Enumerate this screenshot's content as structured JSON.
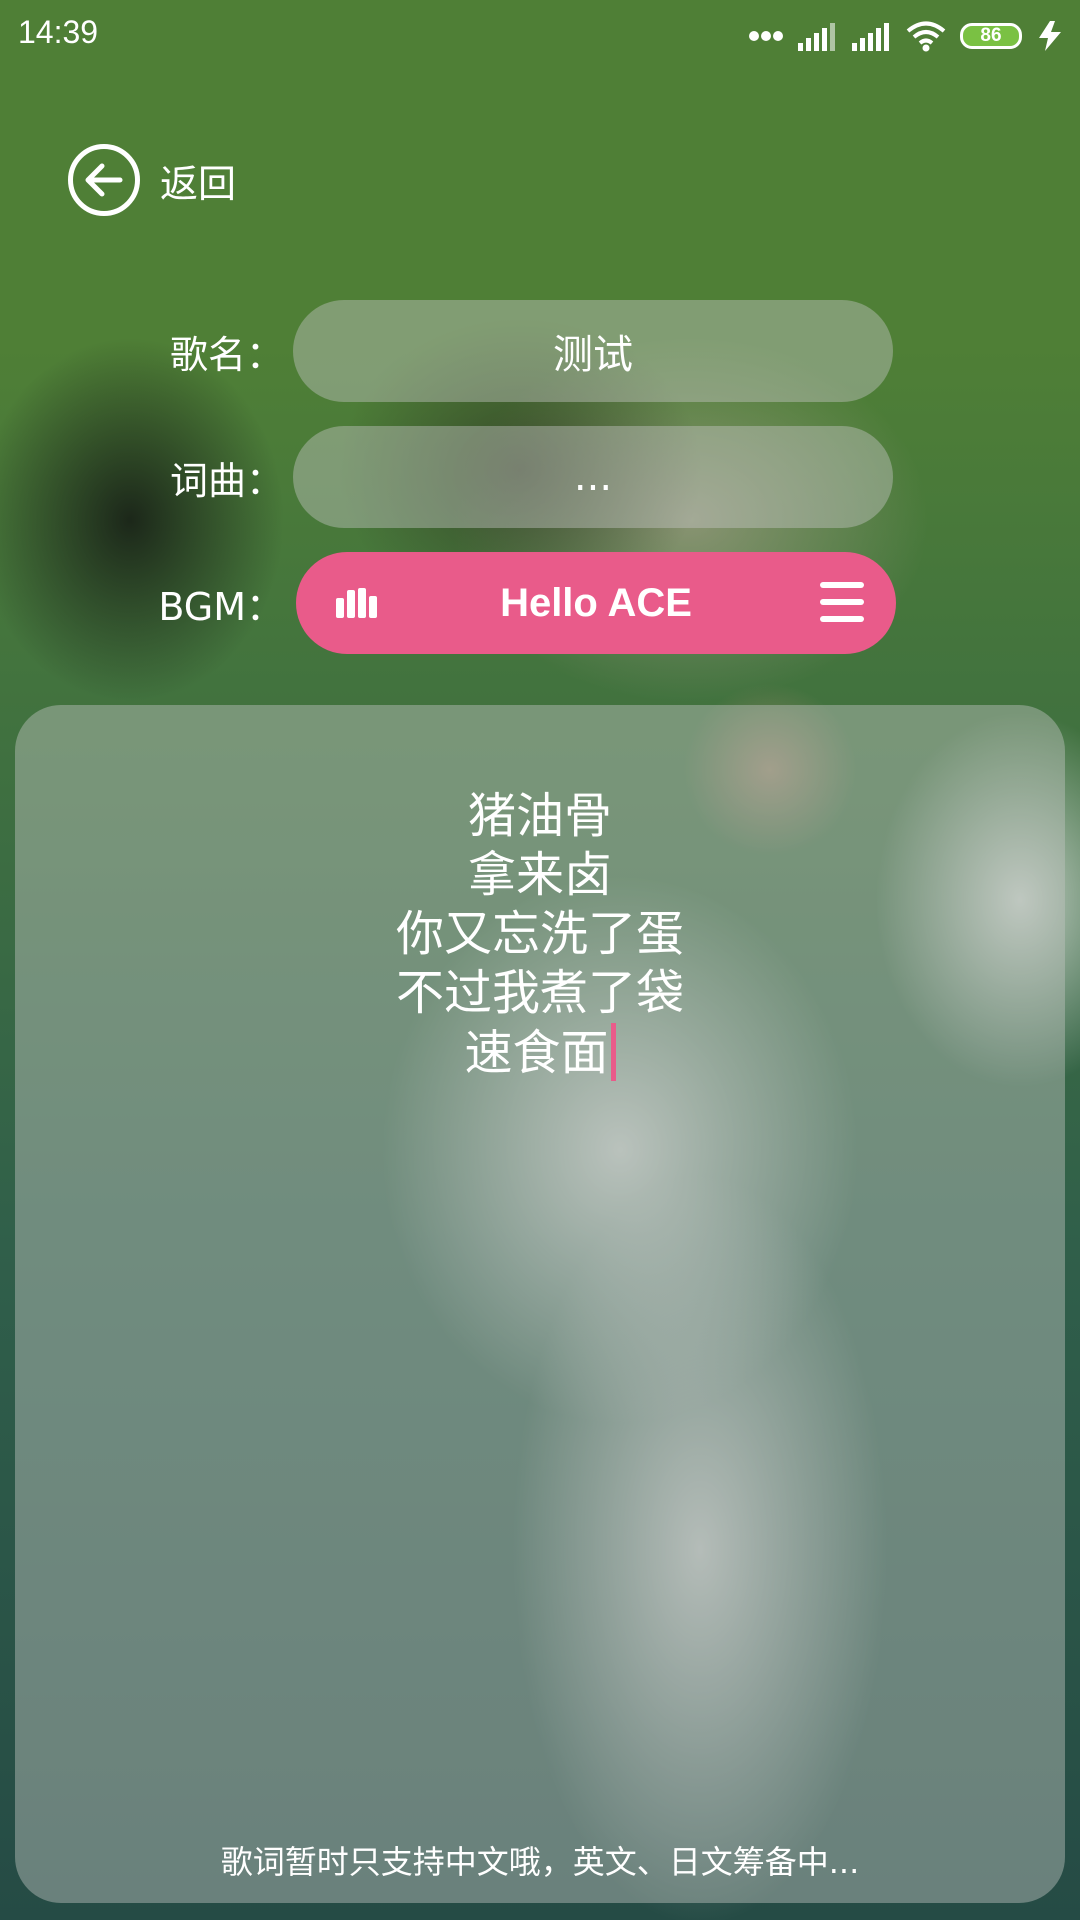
{
  "status_bar": {
    "time": "14:39",
    "battery": "86",
    "icons": [
      "dots-icon",
      "signal-icon",
      "signal-icon",
      "wifi-icon",
      "battery-icon",
      "charging-icon"
    ]
  },
  "header": {
    "back_label": "返回",
    "back_icon": "arrow-left-circle-icon"
  },
  "form": {
    "song_name_label": "歌名：",
    "song_name_value": "测试",
    "lyricist_label": "词曲：",
    "lyricist_value": "...",
    "bgm_label": "BGM：",
    "bgm_value": "Hello ACE",
    "bgm_left_icon": "equalizer-bars-icon",
    "bgm_right_icon": "menu-icon"
  },
  "lyrics": {
    "lines": [
      "猪油骨",
      "拿来卤",
      "你又忘洗了蛋",
      "不过我煮了袋",
      "速食面"
    ]
  },
  "note": "歌词暂时只支持中文哦，英文、日文筹备中...",
  "colors": {
    "accent": "#e95b8a",
    "pill_bg": "rgba(200,200,200,0.42)",
    "battery": "#7ac143"
  }
}
